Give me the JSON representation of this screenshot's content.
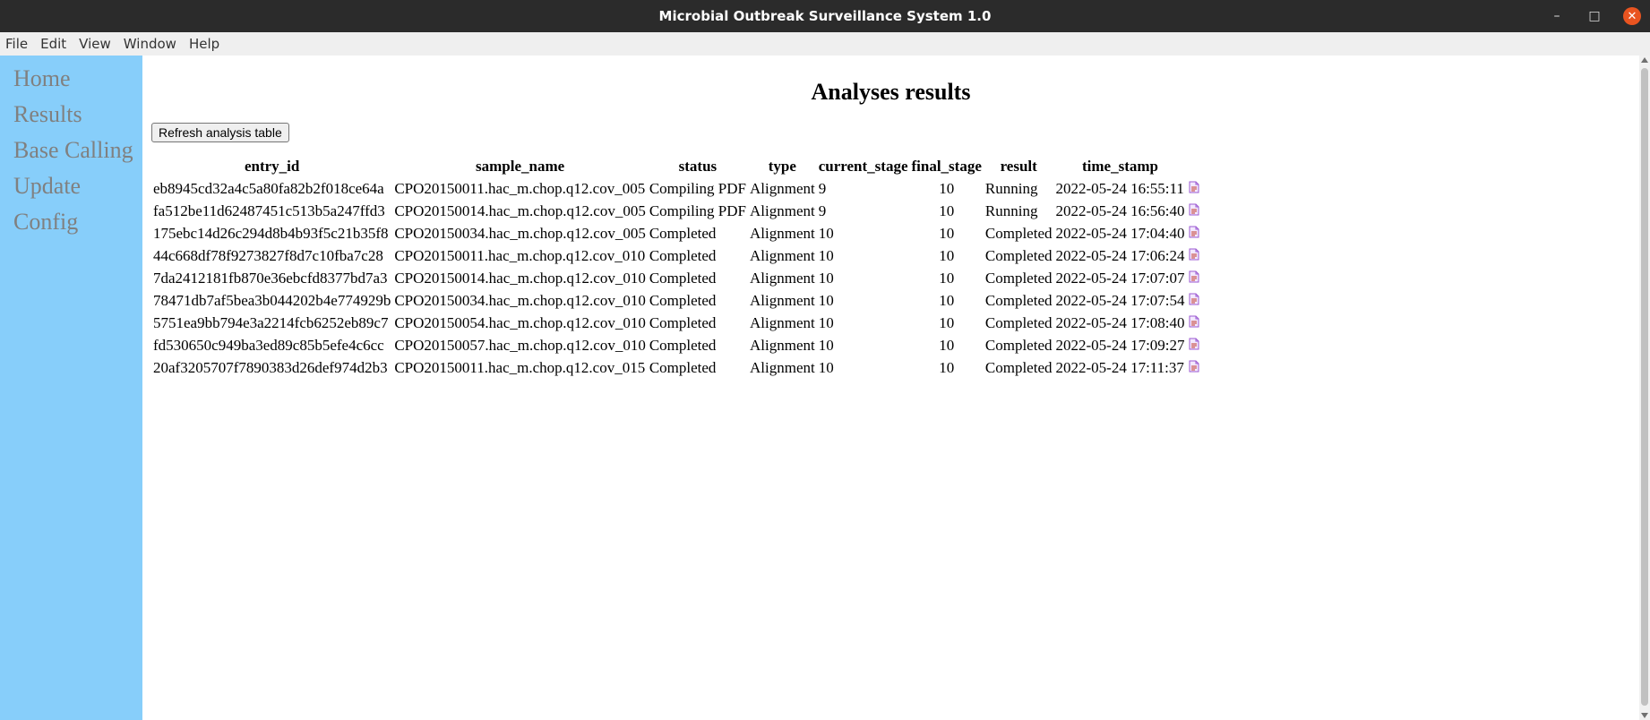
{
  "window": {
    "title": "Microbial Outbreak Surveillance System 1.0",
    "minimize_icon": "minimize-icon",
    "maximize_icon": "maximize-icon",
    "close_icon": "close-icon",
    "minimize_glyph": "–",
    "maximize_glyph": "□",
    "close_glyph": "✕"
  },
  "menubar": {
    "items": [
      "File",
      "Edit",
      "View",
      "Window",
      "Help"
    ]
  },
  "sidebar": {
    "background": "#87cefa",
    "items": [
      "Home",
      "Results",
      "Base Calling",
      "Update",
      "Config"
    ]
  },
  "main": {
    "title": "Analyses results",
    "refresh_label": "Refresh analysis table",
    "columns": [
      "entry_id",
      "sample_name",
      "status",
      "type",
      "current_stage",
      "final_stage",
      "result",
      "time_stamp"
    ],
    "rows": [
      [
        "eb8945cd32a4c5a80fa82b2f018ce64a",
        "CPO20150011.hac_m.chop.q12.cov_005",
        "Compiling PDF",
        "Alignment",
        "9",
        "10",
        "Running",
        "2022-05-24 16:55:11"
      ],
      [
        "fa512be11d62487451c513b5a247ffd3",
        "CPO20150014.hac_m.chop.q12.cov_005",
        "Compiling PDF",
        "Alignment",
        "9",
        "10",
        "Running",
        "2022-05-24 16:56:40"
      ],
      [
        "175ebc14d26c294d8b4b93f5c21b35f8",
        "CPO20150034.hac_m.chop.q12.cov_005",
        "Completed",
        "Alignment",
        "10",
        "10",
        "Completed",
        "2022-05-24 17:04:40"
      ],
      [
        "44c668df78f9273827f8d7c10fba7c28",
        "CPO20150011.hac_m.chop.q12.cov_010",
        "Completed",
        "Alignment",
        "10",
        "10",
        "Completed",
        "2022-05-24 17:06:24"
      ],
      [
        "7da2412181fb870e36ebcfd8377bd7a3",
        "CPO20150014.hac_m.chop.q12.cov_010",
        "Completed",
        "Alignment",
        "10",
        "10",
        "Completed",
        "2022-05-24 17:07:07"
      ],
      [
        "78471db7af5bea3b044202b4e774929b",
        "CPO20150034.hac_m.chop.q12.cov_010",
        "Completed",
        "Alignment",
        "10",
        "10",
        "Completed",
        "2022-05-24 17:07:54"
      ],
      [
        "5751ea9bb794e3a2214fcb6252eb89c7",
        "CPO20150054.hac_m.chop.q12.cov_010",
        "Completed",
        "Alignment",
        "10",
        "10",
        "Completed",
        "2022-05-24 17:08:40"
      ],
      [
        "fd530650c949ba3ed89c85b5efe4c6cc",
        "CPO20150057.hac_m.chop.q12.cov_010",
        "Completed",
        "Alignment",
        "10",
        "10",
        "Completed",
        "2022-05-24 17:09:27"
      ],
      [
        "20af3205707f7890383d26def974d2b3",
        "CPO20150011.hac_m.chop.q12.cov_015",
        "Completed",
        "Alignment",
        "10",
        "10",
        "Completed",
        "2022-05-24 17:11:37"
      ]
    ],
    "row_action_icon": "pdf-report-icon"
  }
}
